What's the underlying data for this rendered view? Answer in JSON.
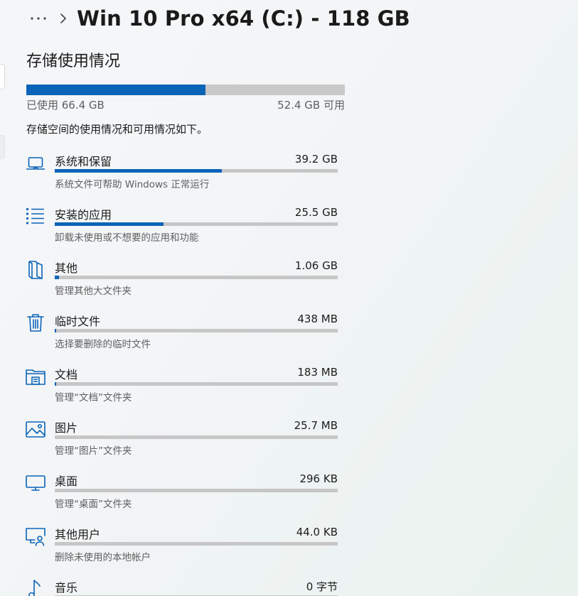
{
  "breadcrumb": {
    "more_icon": "more-horizontal-icon",
    "chevron_icon": "chevron-right-icon",
    "title": "Win 10 Pro x64 (C:) - 118 GB"
  },
  "storage": {
    "section_title": "存储使用情况",
    "used_label": "已使用 66.4 GB",
    "free_label": "52.4 GB 可用",
    "used_fraction": 0.563,
    "description": "存储空间的使用情况和可用情况如下。"
  },
  "colors": {
    "accent": "#0a64b8",
    "track": "#c6c6c6"
  },
  "categories": [
    {
      "icon": "laptop-icon",
      "name": "系统和保留",
      "size": "39.2 GB",
      "sub": "系统文件可帮助 Windows 正常运行",
      "fraction": 0.59
    },
    {
      "icon": "apps-list-icon",
      "name": "安装的应用",
      "size": "25.5 GB",
      "sub": "卸载未使用或不想要的应用和功能",
      "fraction": 0.385
    },
    {
      "icon": "folder-other-icon",
      "name": "其他",
      "size": "1.06 GB",
      "sub": "管理其他大文件夹",
      "fraction": 0.016
    },
    {
      "icon": "trash-icon",
      "name": "临时文件",
      "size": "438 MB",
      "sub": "选择要删除的临时文件",
      "fraction": 0.006
    },
    {
      "icon": "documents-folder-icon",
      "name": "文档",
      "size": "183 MB",
      "sub": "管理“文档”文件夹",
      "fraction": 0.003
    },
    {
      "icon": "pictures-icon",
      "name": "图片",
      "size": "25.7 MB",
      "sub": "管理“图片”文件夹",
      "fraction": 0
    },
    {
      "icon": "desktop-monitor-icon",
      "name": "桌面",
      "size": "296 KB",
      "sub": "管理“桌面”文件夹",
      "fraction": 0
    },
    {
      "icon": "other-users-icon",
      "name": "其他用户",
      "size": "44.0 KB",
      "sub": "删除未使用的本地帐户",
      "fraction": 0
    },
    {
      "icon": "music-note-icon",
      "name": "音乐",
      "size": "0 字节",
      "sub": "",
      "fraction": 0
    }
  ]
}
